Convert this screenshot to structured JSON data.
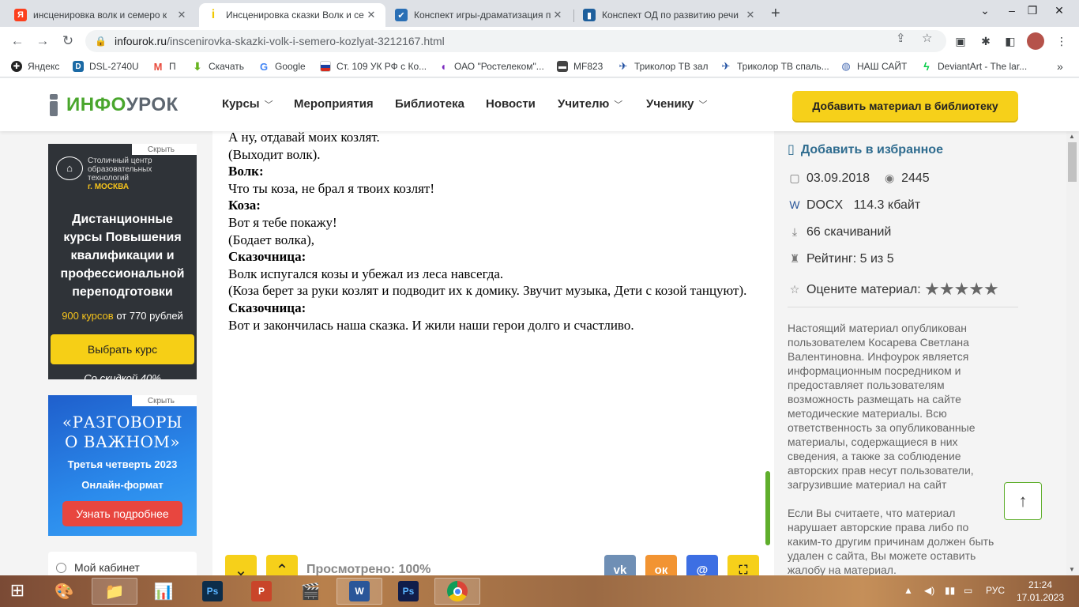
{
  "browser": {
    "tabs": [
      {
        "title": "инсценировка волк и семеро к",
        "favicon": "yandex-icon",
        "color": "#fc3f1d"
      },
      {
        "title": "Инсценировка сказки Волк и се",
        "favicon": "infourok-icon",
        "color": "#f6d01a"
      },
      {
        "title": "Конспект игры-драматизация п",
        "favicon": "checkbox-icon",
        "color": "#2a6fb5"
      },
      {
        "title": "Конспект ОД по развитию речи",
        "favicon": "book-icon",
        "color": "#1e5f9c"
      }
    ],
    "url_host": "infourok.ru",
    "url_path": "/inscenirovka-skazki-volk-i-semero-kozlyat-3212167.html",
    "bookmarks": [
      {
        "label": "Яндекс",
        "icon": "yandex-icon",
        "color": "#222"
      },
      {
        "label": "DSL-2740U",
        "icon": "d-link-icon",
        "color": "#1b6aa5"
      },
      {
        "label": "П",
        "icon": "gmail-icon",
        "color": "#e84b3c"
      },
      {
        "label": "Скачать",
        "icon": "download-icon",
        "color": "#67b31f"
      },
      {
        "label": "Google",
        "icon": "google-icon",
        "color": "#4285f4"
      },
      {
        "label": "Ст. 109 УК РФ с Ко...",
        "icon": "russia-flag-icon",
        "color": "#d52b1e"
      },
      {
        "label": "ОАО \"Ростелеком\"...",
        "icon": "rostelecom-icon",
        "color": "#7b2cbf"
      },
      {
        "label": "MF823",
        "icon": "router-icon",
        "color": "#444"
      },
      {
        "label": "Триколор ТВ зал",
        "icon": "tricolor-icon",
        "color": "#1d4da0"
      },
      {
        "label": "Триколор ТВ спаль...",
        "icon": "tricolor-icon",
        "color": "#1d4da0"
      },
      {
        "label": "НАШ САЙТ",
        "icon": "site-icon",
        "color": "#4c6fb5"
      },
      {
        "label": "DeviantArt - The lar...",
        "icon": "deviantart-icon",
        "color": "#05cc47"
      }
    ],
    "more_bookmarks": "»"
  },
  "site": {
    "logo_green": "ИНФО",
    "logo_gray": "УРОК",
    "nav": [
      {
        "label": "Курсы",
        "dropdown": true
      },
      {
        "label": "Мероприятия",
        "dropdown": false
      },
      {
        "label": "Библиотека",
        "dropdown": false
      },
      {
        "label": "Новости",
        "dropdown": false
      },
      {
        "label": "Учителю",
        "dropdown": true
      },
      {
        "label": "Ученику",
        "dropdown": true
      }
    ],
    "cta_label": "Добавить материал в библиотеку"
  },
  "ads": {
    "hide_label": "Скрыть",
    "ad1": {
      "brand_line1": "Столичный центр",
      "brand_line2": "образовательных",
      "brand_line3": "технологий",
      "brand_city": "г. МОСКВА",
      "headline": "Дистанционные курсы Повышения квалификации и профессиональной переподготовки",
      "price_highlight": "900 курсов",
      "price_rest": "от 770 рублей",
      "button": "Выбрать курс",
      "discount": "Со скидкой 40%"
    },
    "ad2": {
      "headline_line1": "«РАЗГОВОРЫ",
      "headline_line2": "О ВАЖНОМ»",
      "sub1": "Третья четверть 2023",
      "sub2": "Онлайн-формат",
      "button": "Узнать подробнее"
    },
    "cabinet": "Мой кабинет"
  },
  "document": {
    "lines": [
      {
        "text": "А ну, отдавай моих козлят.",
        "bold": false
      },
      {
        "text": "(Выходит волк).",
        "bold": false
      },
      {
        "text": "Волк:",
        "bold": true
      },
      {
        "text": "Что ты коза, не брал я твоих козлят!",
        "bold": false
      },
      {
        "text": "Коза:",
        "bold": true
      },
      {
        "text": "Вот я тебе покажу!",
        "bold": false
      },
      {
        "text": "(Бодает волка),",
        "bold": false
      },
      {
        "text": "Сказочница:",
        "bold": true
      },
      {
        "text": "Волк испугался козы и убежал из леса навсегда.",
        "bold": false
      },
      {
        "text": "(Коза берет за руки козлят и подводит их к домику. Звучит музыка, Дети с козой танцуют).",
        "bold": false
      },
      {
        "text": "Сказочница:",
        "bold": true
      },
      {
        "text": "Вот и закончилась наша сказка. И жили наши герои долго и счастливо.",
        "bold": false
      }
    ],
    "viewed": "Просмотрено: 100%",
    "viewed_percent": 100,
    "share": [
      {
        "name": "vk-share-button",
        "label": "vk",
        "color": "#6f8fb5"
      },
      {
        "name": "ok-share-button",
        "label": "ок",
        "color": "#f29432"
      },
      {
        "name": "mail-share-button",
        "label": "@",
        "color": "#3d6fe3"
      }
    ]
  },
  "info": {
    "favorite": "Добавить в избранное",
    "date": "03.09.2018",
    "views": "2445",
    "format": "DOCX",
    "size": "114.3 кбайт",
    "downloads": "66 скачиваний",
    "rating": "Рейтинг: 5 из 5",
    "rate_label": "Оцените материал:",
    "stars": 5,
    "disclaimer1": "Настоящий материал опубликован пользователем Косарева Светлана Валентиновна. Инфоурок является информационным посредником и предоставляет пользователям возможность размещать на сайте методические материалы. Всю ответственность за опубликованные материалы, содержащиеся в них сведения, а также за соблюдение авторских прав несут пользователи, загрузившие материал на сайт",
    "disclaimer2": "Если Вы считаете, что материал нарушает авторские права либо по каким-то другим причинам должен быть удален с сайта, Вы можете оставить жалобу на материал."
  },
  "taskbar": {
    "apps": [
      {
        "name": "paint-icon",
        "label": "🎨",
        "color": "transparent"
      },
      {
        "name": "file-explorer-icon",
        "label": "📁",
        "color": "transparent"
      },
      {
        "name": "system-monitor-icon",
        "label": "📊",
        "color": "transparent"
      },
      {
        "name": "photoshop-icon",
        "label": "Ps",
        "color": "#0c2d4a"
      },
      {
        "name": "powerpoint-icon",
        "label": "P",
        "color": "#c9452a"
      },
      {
        "name": "movie-maker-icon",
        "label": "🎬",
        "color": "transparent"
      },
      {
        "name": "word-icon",
        "label": "W",
        "color": "#2a5699"
      },
      {
        "name": "photoshop-icon-2",
        "label": "Ps",
        "color": "#101d4a"
      },
      {
        "name": "chrome-icon",
        "label": "",
        "color": "transparent"
      }
    ],
    "language": "РУС",
    "time": "21:24",
    "date": "17.01.2023"
  }
}
